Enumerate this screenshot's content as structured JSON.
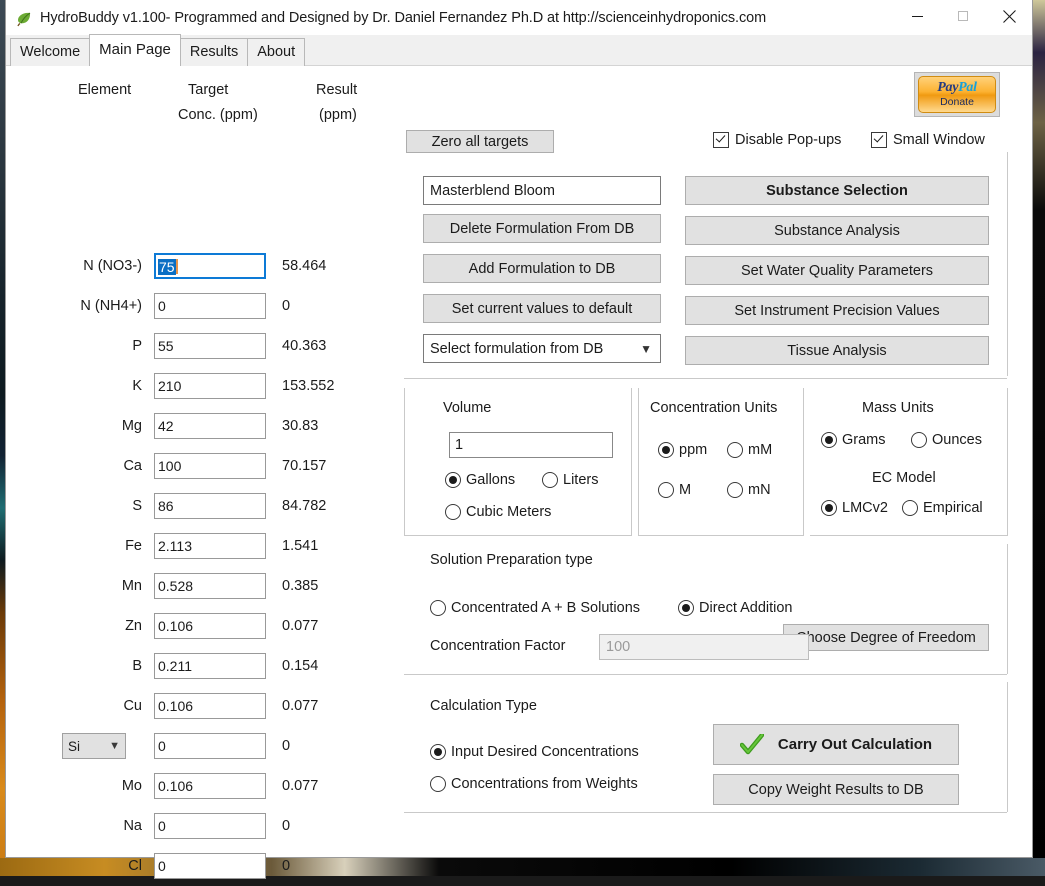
{
  "window": {
    "title": "HydroBuddy v1.100- Programmed and Designed by Dr. Daniel Fernandez Ph.D at http://scienceinhydroponics.com",
    "app_icon": "leaf-icon",
    "minimize_label": "Minimize",
    "maximize_label": "Maximize",
    "close_label": "Close"
  },
  "tabs": [
    {
      "label": "Welcome",
      "active": false
    },
    {
      "label": "Main Page",
      "active": true
    },
    {
      "label": "Results",
      "active": false
    },
    {
      "label": "About",
      "active": false
    }
  ],
  "table": {
    "headers": {
      "element": "Element",
      "target_line1": "Target",
      "target_line2": "Conc. (ppm)",
      "result_line1": "Result",
      "result_line2": "(ppm)"
    },
    "rows": [
      {
        "label": "N (NO3-)",
        "value": "75",
        "result": "58.464",
        "focused": true,
        "select": false
      },
      {
        "label": "N (NH4+)",
        "value": "0",
        "result": "0",
        "focused": false,
        "select": false
      },
      {
        "label": "P",
        "value": "55",
        "result": "40.363",
        "focused": false,
        "select": false
      },
      {
        "label": "K",
        "value": "210",
        "result": "153.552",
        "focused": false,
        "select": false
      },
      {
        "label": "Mg",
        "value": "42",
        "result": "30.83",
        "focused": false,
        "select": false
      },
      {
        "label": "Ca",
        "value": "100",
        "result": "70.157",
        "focused": false,
        "select": false
      },
      {
        "label": "S",
        "value": "86",
        "result": "84.782",
        "focused": false,
        "select": false
      },
      {
        "label": "Fe",
        "value": "2.113",
        "result": "1.541",
        "focused": false,
        "select": false
      },
      {
        "label": "Mn",
        "value": "0.528",
        "result": "0.385",
        "focused": false,
        "select": false
      },
      {
        "label": "Zn",
        "value": "0.106",
        "result": "0.077",
        "focused": false,
        "select": false
      },
      {
        "label": "B",
        "value": "0.211",
        "result": "0.154",
        "focused": false,
        "select": false
      },
      {
        "label": "Cu",
        "value": "0.106",
        "result": "0.077",
        "focused": false,
        "select": false
      },
      {
        "label": "Si",
        "value": "0",
        "result": "0",
        "focused": false,
        "select": true
      },
      {
        "label": "Mo",
        "value": "0.106",
        "result": "0.077",
        "focused": false,
        "select": false
      },
      {
        "label": "Na",
        "value": "0",
        "result": "0",
        "focused": false,
        "select": false
      },
      {
        "label": "Cl",
        "value": "0",
        "result": "0",
        "focused": false,
        "select": false
      }
    ]
  },
  "paypal": {
    "word_pay": "Pay",
    "word_pal": "Pal",
    "donate": "Donate"
  },
  "toolbar": {
    "zero_targets": "Zero all targets",
    "disable_popups": "Disable Pop-ups",
    "small_window": "Small Window"
  },
  "formulation": {
    "name_value": "Masterblend Bloom",
    "delete": "Delete Formulation From DB",
    "add": "Add Formulation to DB",
    "set_default": "Set current values to default",
    "select_placeholder": "Select formulation from DB"
  },
  "actions": {
    "substance_selection": "Substance Selection",
    "substance_analysis": "Substance Analysis",
    "water_quality": "Set Water Quality Parameters",
    "instrument_precision": "Set Instrument Precision Values",
    "tissue_analysis": "Tissue Analysis"
  },
  "volume": {
    "title": "Volume",
    "value": "1",
    "options": [
      {
        "label": "Gallons",
        "selected": true
      },
      {
        "label": "Liters",
        "selected": false
      },
      {
        "label": "Cubic Meters",
        "selected": false
      }
    ]
  },
  "concentration_units": {
    "title": "Concentration Units",
    "options": [
      {
        "label": "ppm",
        "selected": true
      },
      {
        "label": "mM",
        "selected": false
      },
      {
        "label": "M",
        "selected": false
      },
      {
        "label": "mN",
        "selected": false
      }
    ]
  },
  "mass_units": {
    "title": "Mass Units",
    "options": [
      {
        "label": "Grams",
        "selected": true
      },
      {
        "label": "Ounces",
        "selected": false
      }
    ]
  },
  "ec_model": {
    "title": "EC Model",
    "options": [
      {
        "label": "LMCv2",
        "selected": true
      },
      {
        "label": "Empirical",
        "selected": false
      }
    ]
  },
  "solution_prep": {
    "title": "Solution Preparation type",
    "options": [
      {
        "label": "Concentrated A + B Solutions",
        "selected": false
      },
      {
        "label": "Direct Addition",
        "selected": true
      }
    ],
    "factor_label": "Concentration Factor",
    "factor_placeholder": "100",
    "degree_of_freedom": "Choose Degree of Freedom"
  },
  "calculation": {
    "title": "Calculation Type",
    "options": [
      {
        "label": "Input Desired Concentrations",
        "selected": true
      },
      {
        "label": "Concentrations from  Weights",
        "selected": false
      }
    ],
    "carry_out": "Carry Out Calculation",
    "copy_weights": "Copy Weight Results to DB",
    "check_icon": "green-check-icon"
  },
  "colors": {
    "accent": "#0d7ad6",
    "selection": "#0b6fc4",
    "button_face": "#e1e1e1",
    "paypal_blue": "#253b80",
    "paypal_cyan": "#18a0d8",
    "check_green": "#3f9c1f"
  }
}
